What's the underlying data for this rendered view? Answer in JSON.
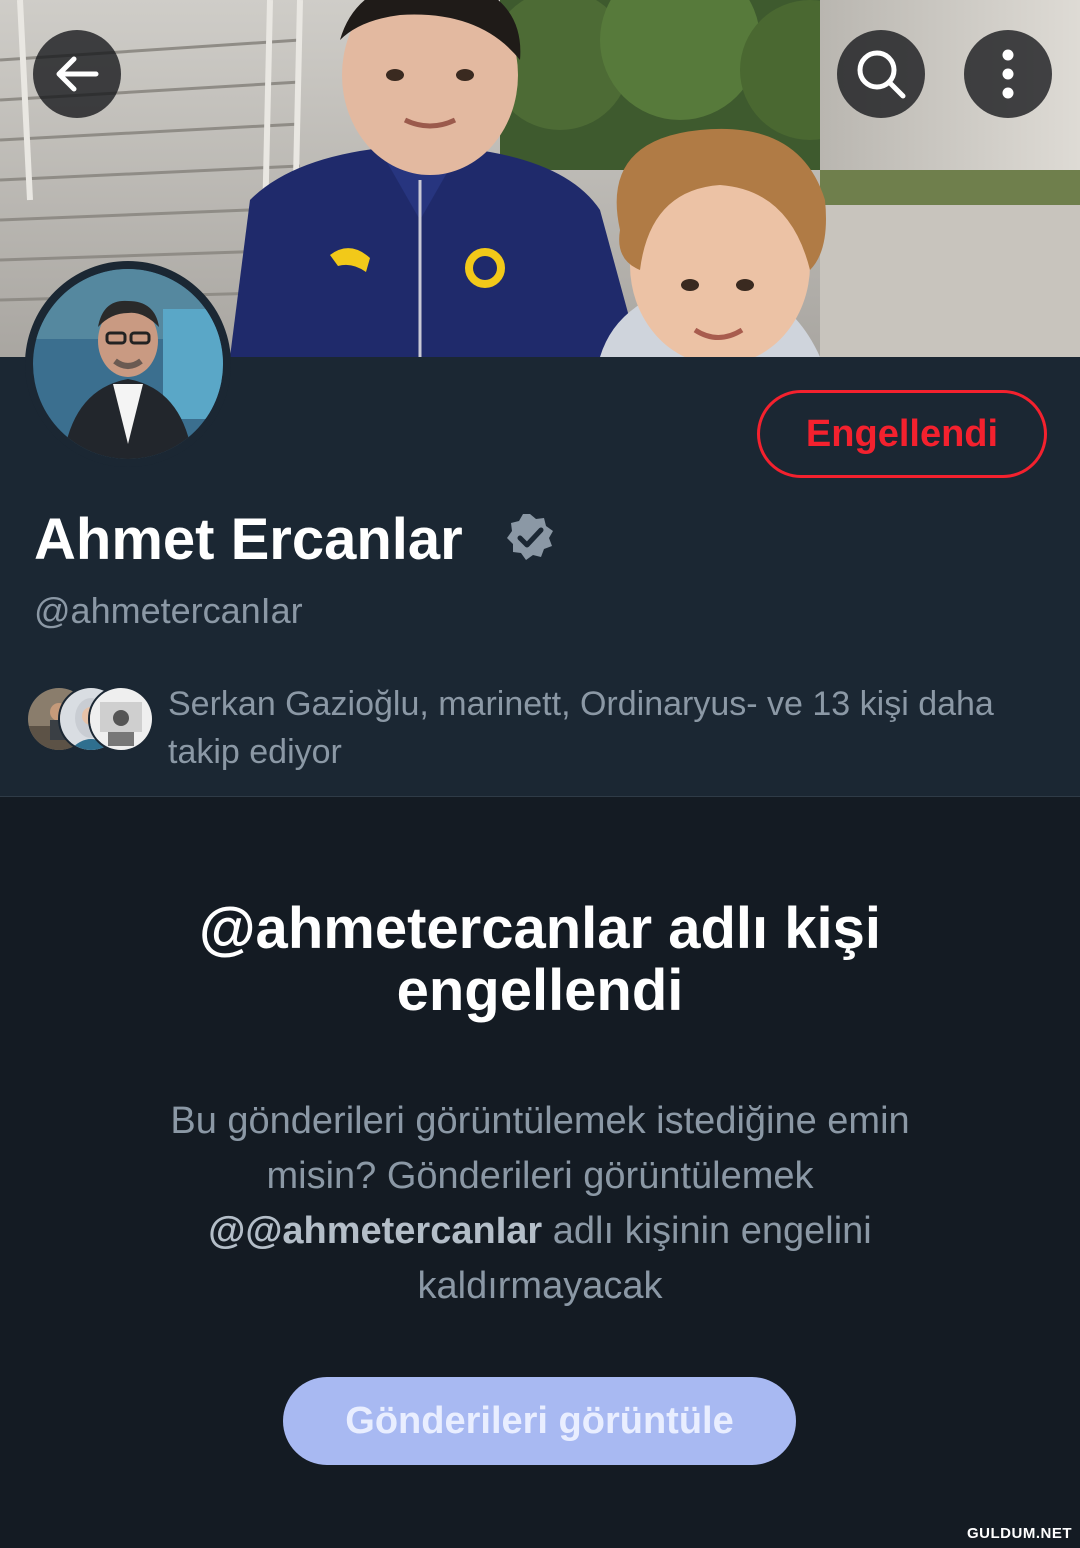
{
  "header": {
    "back_icon": "arrow-left-icon",
    "search_icon": "search-icon",
    "more_icon": "more-vertical-icon"
  },
  "profile": {
    "block_status_label": "Engellendi",
    "display_name": "Ahmet Ercanlar",
    "verified_icon": "verified-badge-icon",
    "handle": "@ahmetercanIar",
    "followers_text": "Serkan Gazioğlu, marinett, Ordinaryus- ve 13 kişi daha takip ediyor"
  },
  "blocked_notice": {
    "title": "@ahmetercanlar adlı kişi engellendi",
    "body_prefix": "Bu gönderileri görüntülemek istediğine emin misin? Gönderileri görüntülemek",
    "body_handle": "@@ahmetercanIar",
    "body_suffix": "adlı kişinin engelini kaldırmayacak",
    "view_posts_label": "Gönderileri görüntüle"
  },
  "watermark": "GULDUM.NET",
  "colors": {
    "background": "#141b23",
    "profile_bg": "#1b2733",
    "blocked_red": "#f4212e",
    "verified_badge": "#8b98a5",
    "view_button": "#a8b9f2"
  }
}
